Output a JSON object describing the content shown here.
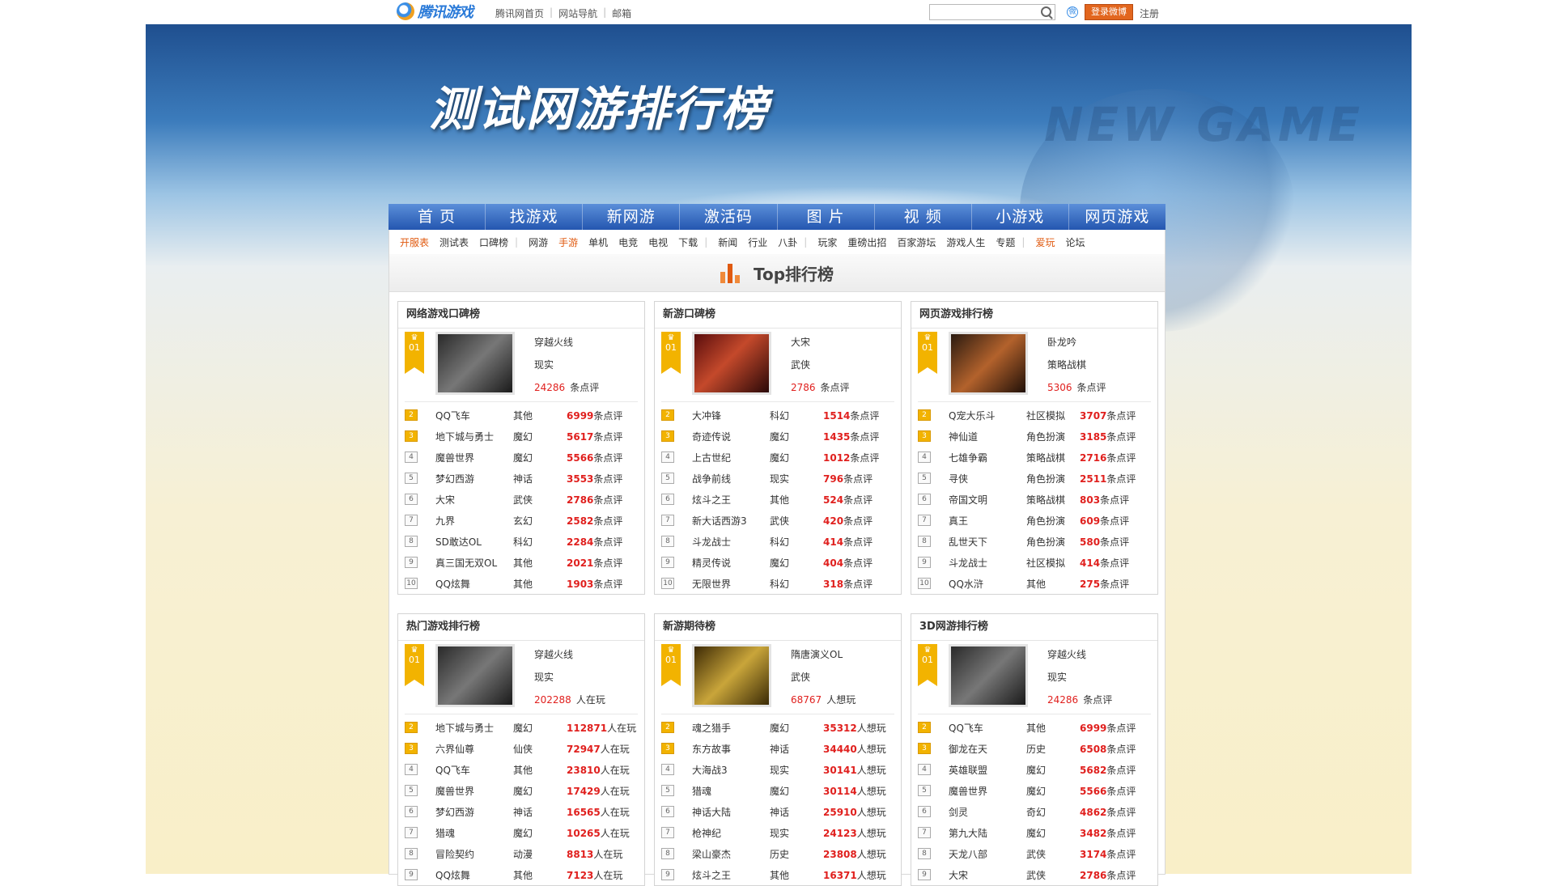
{
  "topbar": {
    "logo_text": "腾讯游戏",
    "links": [
      "腾讯网首页",
      "网站导航",
      "邮箱"
    ],
    "login": "登录微博",
    "register": "注册"
  },
  "banner": {
    "title": "测试网游排行榜",
    "bg_text": "NEW GAME"
  },
  "nav": [
    "首 页",
    "找游戏",
    "新网游",
    "激活码",
    "图 片",
    "视 频",
    "小游戏",
    "网页游戏"
  ],
  "subnav": [
    {
      "t": "开服表",
      "hot": true
    },
    {
      "t": "测试表"
    },
    {
      "t": "口碑榜"
    },
    {
      "bar": true
    },
    {
      "t": "网游"
    },
    {
      "t": "手游",
      "hot": true
    },
    {
      "t": "单机"
    },
    {
      "t": "电竞"
    },
    {
      "t": "电视"
    },
    {
      "t": "下载"
    },
    {
      "bar": true
    },
    {
      "t": "新闻"
    },
    {
      "t": "行业"
    },
    {
      "t": "八卦"
    },
    {
      "bar": true
    },
    {
      "t": "玩家"
    },
    {
      "t": "重磅出招"
    },
    {
      "t": "百家游坛"
    },
    {
      "t": "游戏人生"
    },
    {
      "t": "专题"
    },
    {
      "bar": true
    },
    {
      "t": "爱玩",
      "hot": true
    },
    {
      "t": "论坛"
    }
  ],
  "top_title": "Top排行榜",
  "boards": [
    {
      "title": "网络游戏口碑榜",
      "img": "dark",
      "feat": {
        "rank": "01",
        "name": "穿越火线",
        "genre": "现实",
        "num": "24286",
        "unit": "条点评"
      },
      "rows": [
        [
          "2",
          "QQ飞车",
          "其他",
          "6999",
          "条点评"
        ],
        [
          "3",
          "地下城与勇士",
          "魔幻",
          "5617",
          "条点评"
        ],
        [
          "4",
          "魔兽世界",
          "魔幻",
          "5566",
          "条点评"
        ],
        [
          "5",
          "梦幻西游",
          "神话",
          "3553",
          "条点评"
        ],
        [
          "6",
          "大宋",
          "武侠",
          "2786",
          "条点评"
        ],
        [
          "7",
          "九界",
          "玄幻",
          "2582",
          "条点评"
        ],
        [
          "8",
          "SD敢达OL",
          "科幻",
          "2284",
          "条点评"
        ],
        [
          "9",
          "真三国无双OL",
          "其他",
          "2021",
          "条点评"
        ],
        [
          "10",
          "QQ炫舞",
          "其他",
          "1903",
          "条点评"
        ]
      ]
    },
    {
      "title": "新游口碑榜",
      "img": "warm",
      "feat": {
        "rank": "01",
        "name": "大宋",
        "genre": "武侠",
        "num": "2786",
        "unit": "条点评"
      },
      "rows": [
        [
          "2",
          "大冲锋",
          "科幻",
          "1514",
          "条点评"
        ],
        [
          "3",
          "奇迹传说",
          "魔幻",
          "1435",
          "条点评"
        ],
        [
          "4",
          "上古世纪",
          "魔幻",
          "1012",
          "条点评"
        ],
        [
          "5",
          "战争前线",
          "现实",
          "796",
          "条点评"
        ],
        [
          "6",
          "炫斗之王",
          "其他",
          "524",
          "条点评"
        ],
        [
          "7",
          "新大话西游3",
          "武侠",
          "420",
          "条点评"
        ],
        [
          "8",
          "斗龙战士",
          "科幻",
          "414",
          "条点评"
        ],
        [
          "9",
          "精灵传说",
          "魔幻",
          "404",
          "条点评"
        ],
        [
          "10",
          "无限世界",
          "科幻",
          "318",
          "条点评"
        ]
      ]
    },
    {
      "title": "网页游戏排行榜",
      "img": "fight",
      "feat": {
        "rank": "01",
        "name": "卧龙吟",
        "genre": "策略战棋",
        "num": "5306",
        "unit": "条点评"
      },
      "rows": [
        [
          "2",
          "Q宠大乐斗",
          "社区模拟",
          "3707",
          "条点评"
        ],
        [
          "3",
          "神仙道",
          "角色扮演",
          "3185",
          "条点评"
        ],
        [
          "4",
          "七雄争霸",
          "策略战棋",
          "2716",
          "条点评"
        ],
        [
          "5",
          "寻侠",
          "角色扮演",
          "2511",
          "条点评"
        ],
        [
          "6",
          "帝国文明",
          "策略战棋",
          "803",
          "条点评"
        ],
        [
          "7",
          "真王",
          "角色扮演",
          "609",
          "条点评"
        ],
        [
          "8",
          "乱世天下",
          "角色扮演",
          "580",
          "条点评"
        ],
        [
          "9",
          "斗龙战士",
          "社区模拟",
          "414",
          "条点评"
        ],
        [
          "10",
          "QQ水浒",
          "其他",
          "275",
          "条点评"
        ]
      ]
    },
    {
      "title": "热门游戏排行榜",
      "img": "dark",
      "feat": {
        "rank": "01",
        "name": "穿越火线",
        "genre": "现实",
        "num": "202288",
        "unit": "人在玩"
      },
      "rows": [
        [
          "2",
          "地下城与勇士",
          "魔幻",
          "112871",
          "人在玩"
        ],
        [
          "3",
          "六界仙尊",
          "仙侠",
          "72947",
          "人在玩"
        ],
        [
          "4",
          "QQ飞车",
          "其他",
          "23810",
          "人在玩"
        ],
        [
          "5",
          "魔兽世界",
          "魔幻",
          "17429",
          "人在玩"
        ],
        [
          "6",
          "梦幻西游",
          "神话",
          "16565",
          "人在玩"
        ],
        [
          "7",
          "猎魂",
          "魔幻",
          "10265",
          "人在玩"
        ],
        [
          "8",
          "冒险契约",
          "动漫",
          "8813",
          "人在玩"
        ],
        [
          "9",
          "QQ炫舞",
          "其他",
          "7123",
          "人在玩"
        ]
      ]
    },
    {
      "title": "新游期待榜",
      "img": "gold",
      "feat": {
        "rank": "01",
        "name": "隋唐演义OL",
        "genre": "武侠",
        "num": "68767",
        "unit": "人想玩"
      },
      "rows": [
        [
          "2",
          "魂之猎手",
          "魔幻",
          "35312",
          "人想玩"
        ],
        [
          "3",
          "东方故事",
          "神话",
          "34440",
          "人想玩"
        ],
        [
          "4",
          "大海战3",
          "现实",
          "30141",
          "人想玩"
        ],
        [
          "5",
          "猎魂",
          "魔幻",
          "30114",
          "人想玩"
        ],
        [
          "6",
          "神话大陆",
          "神话",
          "25910",
          "人想玩"
        ],
        [
          "7",
          "枪神纪",
          "现实",
          "24123",
          "人想玩"
        ],
        [
          "8",
          "梁山豪杰",
          "历史",
          "23808",
          "人想玩"
        ],
        [
          "9",
          "炫斗之王",
          "其他",
          "16371",
          "人想玩"
        ]
      ]
    },
    {
      "title": "3D网游排行榜",
      "img": "dark",
      "feat": {
        "rank": "01",
        "name": "穿越火线",
        "genre": "现实",
        "num": "24286",
        "unit": "条点评"
      },
      "rows": [
        [
          "2",
          "QQ飞车",
          "其他",
          "6999",
          "条点评"
        ],
        [
          "3",
          "御龙在天",
          "历史",
          "6508",
          "条点评"
        ],
        [
          "4",
          "英雄联盟",
          "魔幻",
          "5682",
          "条点评"
        ],
        [
          "5",
          "魔兽世界",
          "魔幻",
          "5566",
          "条点评"
        ],
        [
          "6",
          "剑灵",
          "奇幻",
          "4862",
          "条点评"
        ],
        [
          "7",
          "第九大陆",
          "魔幻",
          "3482",
          "条点评"
        ],
        [
          "8",
          "天龙八部",
          "武侠",
          "3174",
          "条点评"
        ],
        [
          "9",
          "大宋",
          "武侠",
          "2786",
          "条点评"
        ]
      ]
    }
  ],
  "colors": {
    "accent": "#e0201e",
    "nav": "#2456b0",
    "gold": "#f2b300",
    "hot": "#e05a10"
  }
}
